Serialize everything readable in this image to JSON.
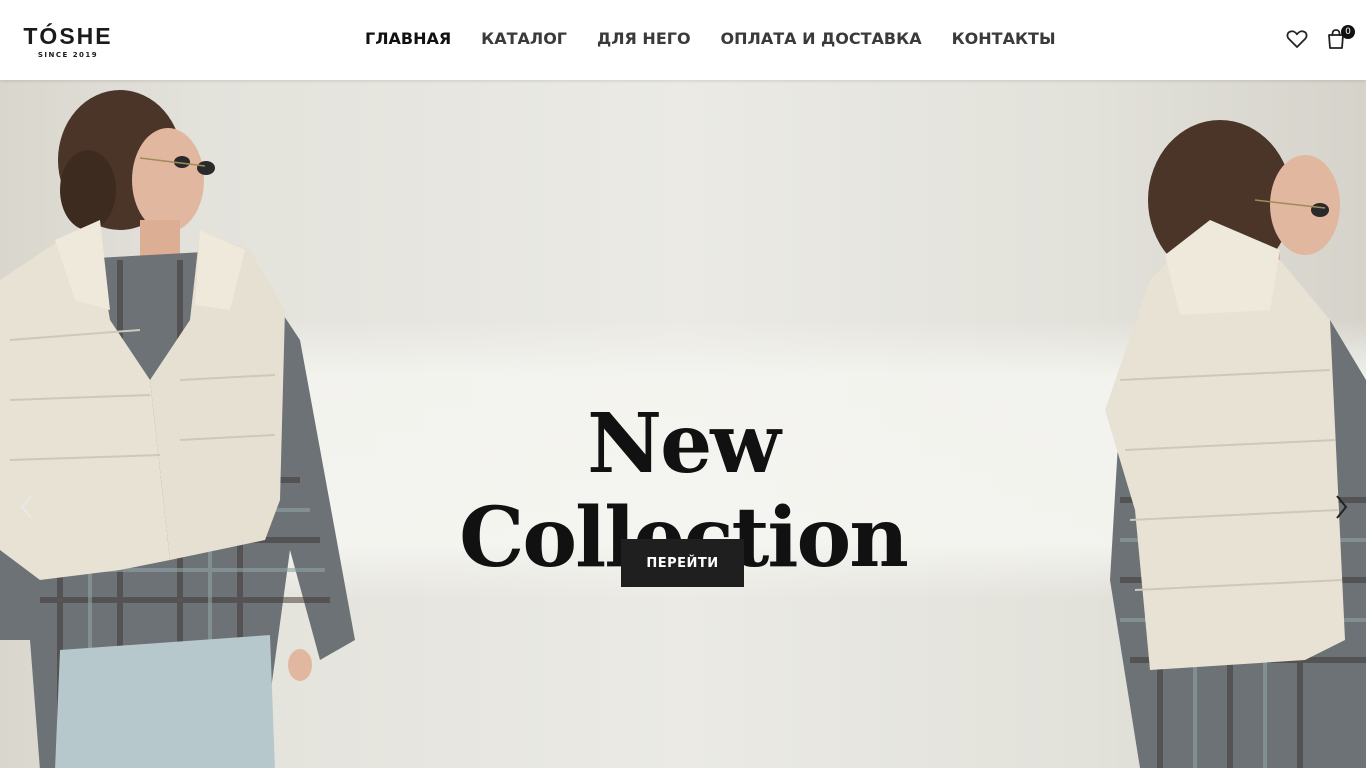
{
  "header": {
    "logo": {
      "name": "TÓSHE",
      "tagline": "SINCE 2019"
    },
    "nav": [
      {
        "label": "ГЛАВНАЯ",
        "active": true
      },
      {
        "label": "КАТАЛОГ",
        "active": false
      },
      {
        "label": "ДЛЯ НЕГО",
        "active": false
      },
      {
        "label": "ОПЛАТА И ДОСТАВКА",
        "active": false
      },
      {
        "label": "КОНТАКТЫ",
        "active": false
      }
    ],
    "icons": {
      "wishlist": "heart-icon",
      "cart": "shopping-bag-icon"
    },
    "cart_count": "0"
  },
  "hero": {
    "title_line1": "New",
    "title_line2": "Collection",
    "button_label": "ПЕРЕЙТИ",
    "prev_icon": "chevron-left-icon",
    "next_icon": "chevron-right-icon"
  },
  "colors": {
    "text_dark": "#111111",
    "button_bg": "#1f1f1f",
    "header_bg": "#ffffff"
  }
}
